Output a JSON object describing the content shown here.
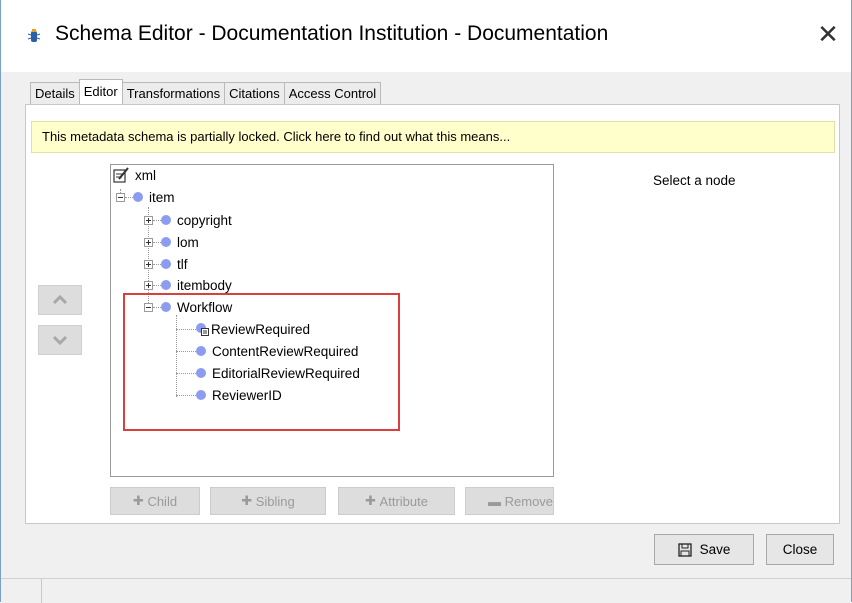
{
  "window": {
    "title": "Schema Editor - Documentation Institution - Documentation",
    "close_glyph": "✕"
  },
  "tabs": [
    {
      "label": "Details"
    },
    {
      "label": "Editor",
      "active": true
    },
    {
      "label": "Transformations"
    },
    {
      "label": "Citations"
    },
    {
      "label": "Access Control"
    }
  ],
  "banner": {
    "text": "This metadata schema is partially locked.  Click here to find out what this means..."
  },
  "tree": {
    "root": "xml",
    "item": "item",
    "children": [
      "copyright",
      "lom",
      "tlf",
      "itembody"
    ],
    "workflow": "Workflow",
    "workflow_children": [
      "ReviewRequired",
      "ContentReviewRequired",
      "EditorialReviewRequired",
      "ReviewerID"
    ]
  },
  "toolbar": {
    "child": "Child",
    "sibling": "Sibling",
    "attribute": "Attribute",
    "remove": "Remove"
  },
  "detail": {
    "placeholder": "Select a node"
  },
  "footer": {
    "save": "Save",
    "close": "Close"
  },
  "colors": {
    "node_dot": "#8c9cf0",
    "highlight": "#d9403d",
    "banner_bg": "#ffffcc"
  },
  "icons": {
    "root": "xml-edit-icon",
    "node": "node-dot-icon",
    "up": "chevron-up-icon",
    "down": "chevron-down-icon",
    "save": "floppy-disk-icon"
  }
}
